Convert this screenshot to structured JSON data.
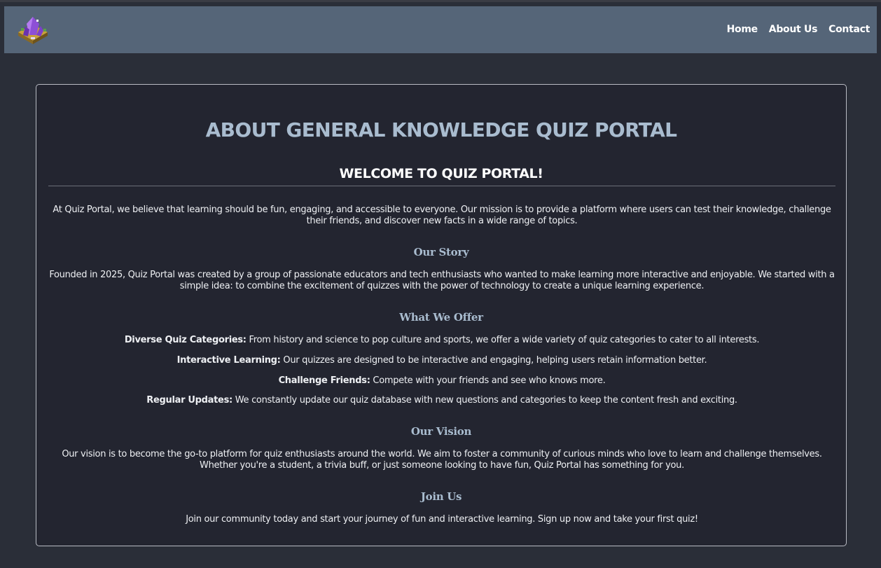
{
  "nav": {
    "logo": "quiz-portal-logo",
    "links": [
      "Home",
      "About Us",
      "Contact"
    ]
  },
  "page": {
    "title": "ABOUT GENERAL KNOWLEDGE QUIZ PORTAL",
    "welcome": "WELCOME TO QUIZ PORTAL!",
    "intro": "At Quiz Portal, we believe that learning should be fun, engaging, and accessible to everyone. Our mission is to provide a platform where users can test their knowledge, challenge their friends, and discover new facts in a wide range of topics."
  },
  "story": {
    "heading": "Our Story",
    "text": "Founded in 2025, Quiz Portal was created by a group of passionate educators and tech enthusiasts who wanted to make learning more interactive and enjoyable. We started with a simple idea: to combine the excitement of quizzes with the power of technology to create a unique learning experience."
  },
  "offer": {
    "heading": "What We Offer",
    "items": [
      {
        "label": "Diverse Quiz Categories:",
        "text": " From history and science to pop culture and sports, we offer a wide variety of quiz categories to cater to all interests."
      },
      {
        "label": "Interactive Learning:",
        "text": " Our quizzes are designed to be interactive and engaging, helping users retain information better."
      },
      {
        "label": "Challenge Friends:",
        "text": " Compete with your friends and see who knows more."
      },
      {
        "label": "Regular Updates:",
        "text": " We constantly update our quiz database with new questions and categories to keep the content fresh and exciting."
      }
    ]
  },
  "vision": {
    "heading": "Our Vision",
    "text": "Our vision is to become the go-to platform for quiz enthusiasts around the world. We aim to foster a community of curious minds who love to learn and challenge themselves. Whether you're a student, a trivia buff, or just someone looking to have fun, Quiz Portal has something for you."
  },
  "join": {
    "heading": "Join Us",
    "text": "Join our community today and start your journey of fun and interactive learning. Sign up now and take your first quiz!"
  },
  "colors": {
    "background": "#2a2e38",
    "navbar": "#556578",
    "card": "#232530",
    "heading_accent": "#a9bccf"
  }
}
